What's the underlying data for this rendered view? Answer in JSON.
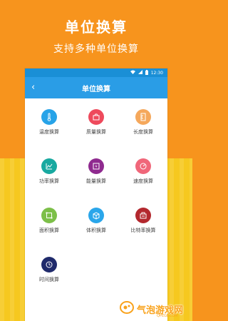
{
  "hero": {
    "title": "单位换算",
    "subtitle": "支持多种单位换算"
  },
  "statusbar": {
    "time": "12:30"
  },
  "appbar": {
    "back": "‹",
    "title": "单位换算"
  },
  "items": [
    {
      "label": "温度换算",
      "icon": "thermometer-icon",
      "color": "#27a3e8"
    },
    {
      "label": "质量换算",
      "icon": "scale-icon",
      "color": "#ee4a5c"
    },
    {
      "label": "长度换算",
      "icon": "ruler-icon",
      "color": "#f5a85c"
    },
    {
      "label": "功率换算",
      "icon": "power-chart-icon",
      "color": "#18a9a0"
    },
    {
      "label": "能量换算",
      "icon": "energy-icon",
      "color": "#8f2a8f"
    },
    {
      "label": "速度换算",
      "icon": "speedometer-icon",
      "color": "#f0677a"
    },
    {
      "label": "面积换算",
      "icon": "area-icon",
      "color": "#7cbf48"
    },
    {
      "label": "体积换算",
      "icon": "volume-cube-icon",
      "color": "#2aa6ea"
    },
    {
      "label": "比特率换算",
      "icon": "bitrate-icon",
      "color": "#b3282e"
    },
    {
      "label": "时间换算",
      "icon": "clock-icon",
      "color": "#1f2a6b"
    }
  ],
  "watermark": {
    "text": "气泡游戏网",
    "sub": "QPEGF.COM"
  }
}
